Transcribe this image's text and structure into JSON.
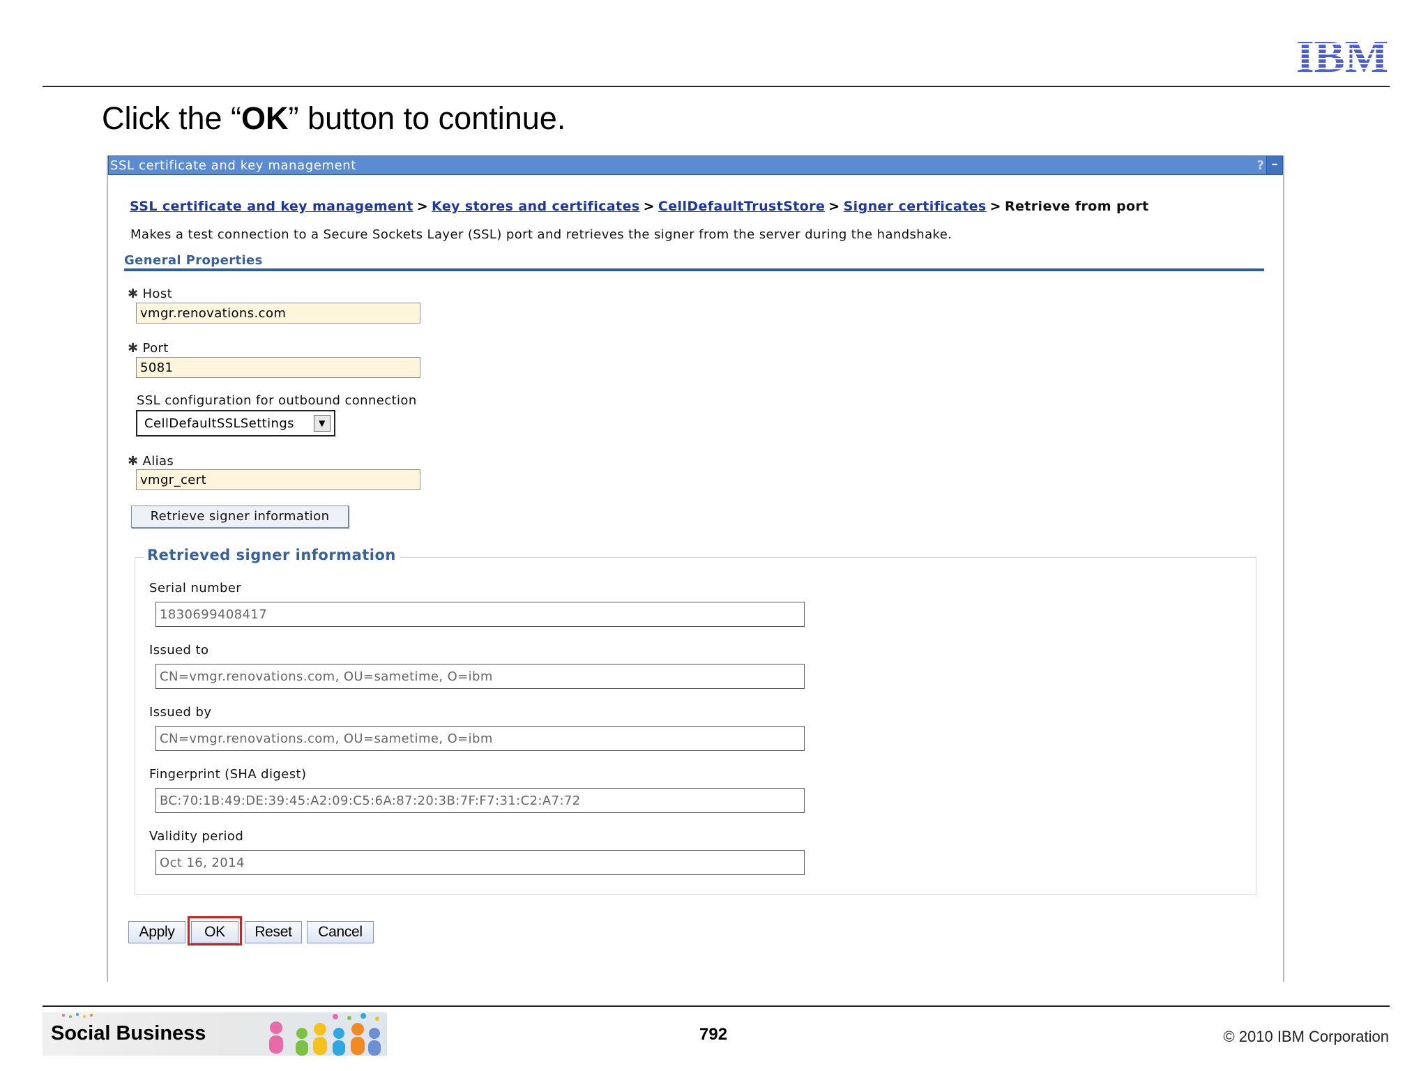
{
  "slide": {
    "title_pre": "Click the “",
    "title_bold": "OK",
    "title_post": "” button to continue.",
    "page_number": "792",
    "copyright": "© 2010 IBM Corporation",
    "banner_text": "Social Business",
    "logo": "IBM"
  },
  "panel": {
    "title": "SSL certificate and key management",
    "help_label": "?",
    "minimize_label": "–"
  },
  "breadcrumb": {
    "links": [
      "SSL certificate and key management",
      "Key stores and certificates",
      "CellDefaultTrustStore",
      "Signer certificates"
    ],
    "separator": ">",
    "current": "Retrieve from port"
  },
  "description": "Makes a test connection to a Secure Sockets Layer (SSL) port and retrieves the signer from the server during the handshake.",
  "general": {
    "title": "General Properties",
    "required_marker": "✱",
    "host": {
      "label": "Host",
      "value": "vmgr.renovations.com"
    },
    "port": {
      "label": "Port",
      "value": "5081"
    },
    "ssl_config": {
      "label": "SSL configuration for outbound connection",
      "value": "CellDefaultSSLSettings"
    },
    "alias": {
      "label": "Alias",
      "value": "vmgr_cert"
    },
    "retrieve_button": "Retrieve signer information"
  },
  "signer": {
    "legend": "Retrieved signer information",
    "serial": {
      "label": "Serial number",
      "value": "1830699408417"
    },
    "issued_to": {
      "label": "Issued to",
      "value": "CN=vmgr.renovations.com, OU=sametime, O=ibm"
    },
    "issued_by": {
      "label": "Issued by",
      "value": "CN=vmgr.renovations.com, OU=sametime, O=ibm"
    },
    "fingerprint": {
      "label": "Fingerprint (SHA digest)",
      "value": "BC:70:1B:49:DE:39:45:A2:09:C5:6A:87:20:3B:7F:F7:31:C2:A7:72"
    },
    "validity": {
      "label": "Validity period",
      "value": "Oct 16, 2014"
    }
  },
  "buttons": {
    "apply": "Apply",
    "ok": "OK",
    "reset": "Reset",
    "cancel": "Cancel"
  },
  "colors": {
    "titlebar": "#5b8bd0",
    "link": "#1a37a8",
    "section": "#36609e",
    "field_bg": "#fdf5dc",
    "highlight": "#d21f1f",
    "ibm_blue": "#4a5dd6"
  }
}
